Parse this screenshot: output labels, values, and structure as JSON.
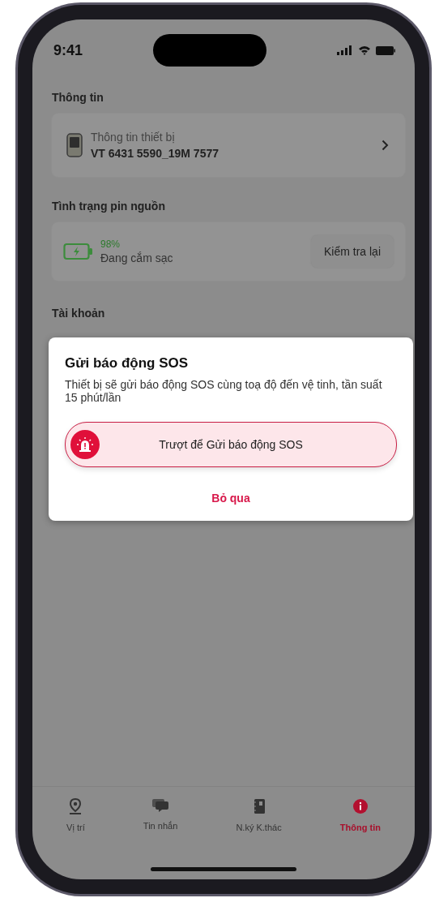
{
  "status_bar": {
    "time": "9:41"
  },
  "info_section": {
    "title": "Thông tin",
    "device_card": {
      "label": "Thông tin thiết bị",
      "value": "VT 6431 5590_19M 7577"
    }
  },
  "battery_section": {
    "title": "Tình trạng pin nguồn",
    "percent": "98%",
    "status": "Đang cắm sạc",
    "button": "Kiểm tra lại"
  },
  "account_section": {
    "title": "Tài khoản"
  },
  "dialog": {
    "title": "Gửi báo động SOS",
    "message": "Thiết bị sẽ gửi báo động SOS cùng toạ độ đến vệ tinh, tần suất 15 phút/lần",
    "slider": {
      "label": "Trượt để Gửi báo động SOS",
      "level": 0
    },
    "dismiss": "Bỏ qua"
  },
  "tab_bar": [
    {
      "label": "Vị trí",
      "selected": false
    },
    {
      "label": "Tin nhắn",
      "selected": false
    },
    {
      "label": "N.ký K.thác",
      "selected": false
    },
    {
      "label": "Thông tin",
      "selected": true
    }
  ]
}
